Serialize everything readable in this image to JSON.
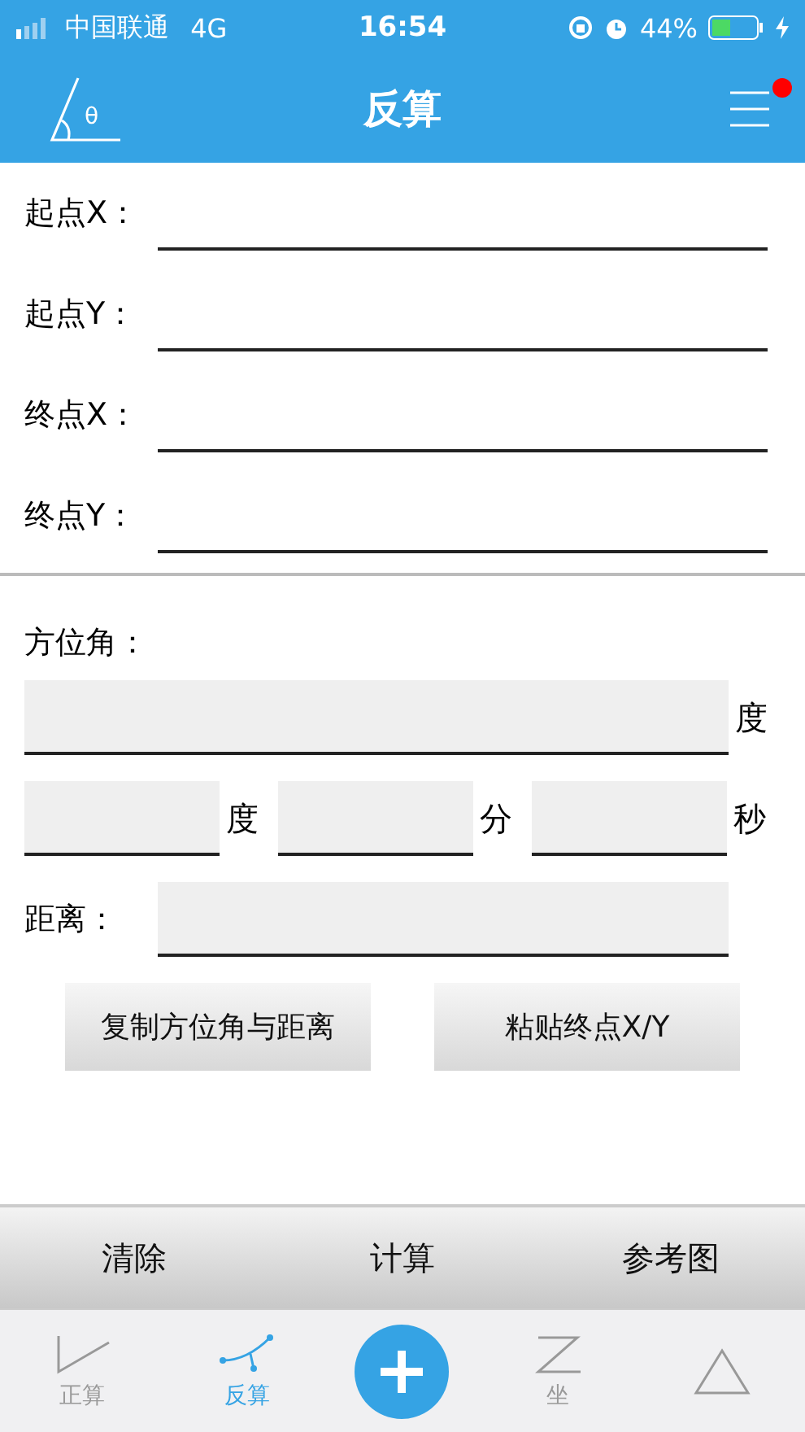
{
  "status_bar": {
    "carrier": "中国联通",
    "network": "4G",
    "time": "16:54",
    "battery": "44%"
  },
  "header": {
    "icon_symbol": "θ",
    "title": "反算",
    "menu_badge": true
  },
  "point_fields": [
    {
      "label": "起点X："
    },
    {
      "label": "起点Y："
    },
    {
      "label": "终点X："
    },
    {
      "label": "终点Y："
    }
  ],
  "azimuth": {
    "label": "方位角：",
    "unit": "度"
  },
  "dms_fields": [
    {
      "unit": "度"
    },
    {
      "unit": "分"
    },
    {
      "unit": "秒"
    }
  ],
  "distance": {
    "label": "距离："
  },
  "buttons": [
    "复制方位角与距离",
    "粘贴终点X/Y"
  ],
  "action_bar": [
    "清除",
    "计算",
    "参考图"
  ],
  "tabs": [
    {
      "kind": "angle",
      "label": "正算",
      "selected": false
    },
    {
      "kind": "curve",
      "label": "反算",
      "selected": true
    },
    {
      "kind": "add"
    },
    {
      "kind": "coord",
      "label": "坐",
      "selected": false
    },
    {
      "kind": "triangle",
      "selected": false
    }
  ]
}
